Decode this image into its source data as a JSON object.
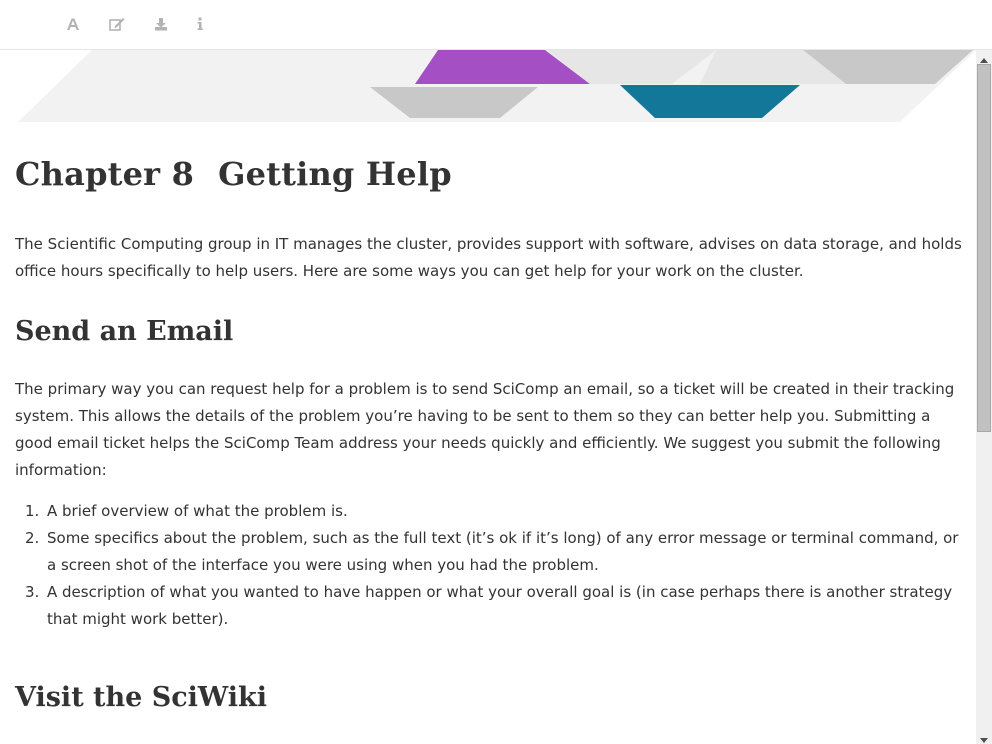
{
  "toolbar": {
    "icons": [
      "font-icon",
      "edit-icon",
      "download-icon",
      "info-icon"
    ]
  },
  "banner": {
    "colors": {
      "purple": "#a44fc4",
      "teal": "#13779a",
      "light_gray": "#e6e6e6",
      "mid_gray": "#c8c8c8",
      "pale_gray": "#f2f2f2"
    }
  },
  "chapter": {
    "number": "Chapter 8",
    "title": "Getting Help",
    "intro": "The Scientific Computing group in IT manages the cluster, provides support with software, advises on data storage, and holds office hours specifically to help users. Here are some ways you can get help for your work on the cluster."
  },
  "sections": {
    "email": {
      "heading": "Send an Email",
      "paragraph": "The primary way you can request help for a problem is to send SciComp an email, so a ticket will be created in their tracking system. This allows the details of the problem you’re having to be sent to them so they can better help you. Submitting a good email ticket helps the SciComp Team address your needs quickly and efficiently. We suggest you submit the following information:",
      "items": [
        {
          "marker": "1.",
          "text": "A brief overview of what the problem is."
        },
        {
          "marker": "2.",
          "text": "Some specifics about the problem, such as the full text (it’s ok if it’s long) of any error message or terminal command, or a screen shot of the interface you were using when you had the problem."
        },
        {
          "marker": "3.",
          "text": "A description of what you wanted to have happen or what your overall goal is (in case perhaps there is another strategy that might work better)."
        }
      ]
    },
    "sciwiki": {
      "heading": "Visit the SciWiki"
    }
  }
}
